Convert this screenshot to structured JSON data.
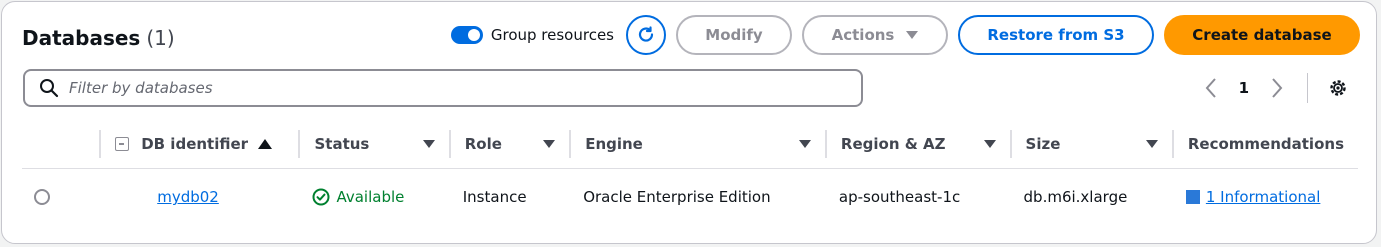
{
  "header": {
    "title": "Databases",
    "count": "(1)"
  },
  "toolbar": {
    "group_label": "Group resources",
    "modify_label": "Modify",
    "actions_label": "Actions",
    "restore_label": "Restore from S3",
    "create_label": "Create database"
  },
  "search": {
    "placeholder": "Filter by databases"
  },
  "pagination": {
    "current_page": "1"
  },
  "table": {
    "columns": [
      "DB identifier",
      "Status",
      "Role",
      "Engine",
      "Region & AZ",
      "Size",
      "Recommendations"
    ],
    "rows": [
      {
        "db_identifier": "mydb02",
        "status": "Available",
        "role": "Instance",
        "engine": "Oracle Enterprise Edition",
        "region_az": "ap-southeast-1c",
        "size": "db.m6i.xlarge",
        "recommendations": "1 Informational"
      }
    ]
  },
  "colors": {
    "accent": "#006ce0",
    "primary": "#ff9900",
    "success": "#00802f"
  },
  "icons": [
    "refresh-icon",
    "search-icon",
    "chevron-left-icon",
    "chevron-right-icon",
    "settings-gear-icon",
    "check-circle-icon"
  ]
}
